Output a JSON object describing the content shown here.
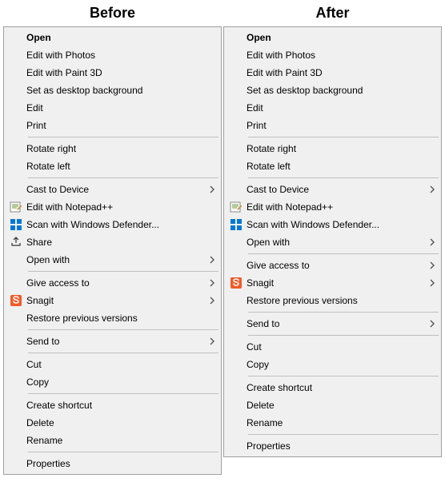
{
  "headings": {
    "before": "Before",
    "after": "After"
  },
  "menus": {
    "before": [
      {
        "type": "item",
        "label": "Open",
        "bold": true
      },
      {
        "type": "item",
        "label": "Edit with Photos"
      },
      {
        "type": "item",
        "label": "Edit with Paint 3D"
      },
      {
        "type": "item",
        "label": "Set as desktop background"
      },
      {
        "type": "item",
        "label": "Edit"
      },
      {
        "type": "item",
        "label": "Print"
      },
      {
        "type": "sep"
      },
      {
        "type": "item",
        "label": "Rotate right"
      },
      {
        "type": "item",
        "label": "Rotate left"
      },
      {
        "type": "sep"
      },
      {
        "type": "item",
        "label": "Cast to Device",
        "submenu": true
      },
      {
        "type": "item",
        "label": "Edit with Notepad++",
        "icon": "notepadpp"
      },
      {
        "type": "item",
        "label": "Scan with Windows Defender...",
        "icon": "defender"
      },
      {
        "type": "item",
        "label": "Share",
        "icon": "share"
      },
      {
        "type": "item",
        "label": "Open with",
        "submenu": true
      },
      {
        "type": "sep"
      },
      {
        "type": "item",
        "label": "Give access to",
        "submenu": true
      },
      {
        "type": "item",
        "label": "Snagit",
        "icon": "snagit",
        "submenu": true
      },
      {
        "type": "item",
        "label": "Restore previous versions"
      },
      {
        "type": "sep"
      },
      {
        "type": "item",
        "label": "Send to",
        "submenu": true
      },
      {
        "type": "sep"
      },
      {
        "type": "item",
        "label": "Cut"
      },
      {
        "type": "item",
        "label": "Copy"
      },
      {
        "type": "sep"
      },
      {
        "type": "item",
        "label": "Create shortcut"
      },
      {
        "type": "item",
        "label": "Delete"
      },
      {
        "type": "item",
        "label": "Rename"
      },
      {
        "type": "sep"
      },
      {
        "type": "item",
        "label": "Properties"
      }
    ],
    "after": [
      {
        "type": "item",
        "label": "Open",
        "bold": true
      },
      {
        "type": "item",
        "label": "Edit with Photos"
      },
      {
        "type": "item",
        "label": "Edit with Paint 3D"
      },
      {
        "type": "item",
        "label": "Set as desktop background"
      },
      {
        "type": "item",
        "label": "Edit"
      },
      {
        "type": "item",
        "label": "Print"
      },
      {
        "type": "sep"
      },
      {
        "type": "item",
        "label": "Rotate right"
      },
      {
        "type": "item",
        "label": "Rotate left"
      },
      {
        "type": "sep"
      },
      {
        "type": "item",
        "label": "Cast to Device",
        "submenu": true
      },
      {
        "type": "item",
        "label": "Edit with Notepad++",
        "icon": "notepadpp"
      },
      {
        "type": "item",
        "label": "Scan with Windows Defender...",
        "icon": "defender"
      },
      {
        "type": "item",
        "label": "Open with",
        "submenu": true
      },
      {
        "type": "sep"
      },
      {
        "type": "item",
        "label": "Give access to",
        "submenu": true
      },
      {
        "type": "item",
        "label": "Snagit",
        "icon": "snagit",
        "submenu": true
      },
      {
        "type": "item",
        "label": "Restore previous versions"
      },
      {
        "type": "sep"
      },
      {
        "type": "item",
        "label": "Send to",
        "submenu": true
      },
      {
        "type": "sep"
      },
      {
        "type": "item",
        "label": "Cut"
      },
      {
        "type": "item",
        "label": "Copy"
      },
      {
        "type": "sep"
      },
      {
        "type": "item",
        "label": "Create shortcut"
      },
      {
        "type": "item",
        "label": "Delete"
      },
      {
        "type": "item",
        "label": "Rename"
      },
      {
        "type": "sep"
      },
      {
        "type": "item",
        "label": "Properties"
      }
    ]
  },
  "icons": {
    "notepadpp": "notepadpp-icon",
    "defender": "windows-defender-icon",
    "share": "share-icon",
    "snagit": "snagit-icon"
  }
}
